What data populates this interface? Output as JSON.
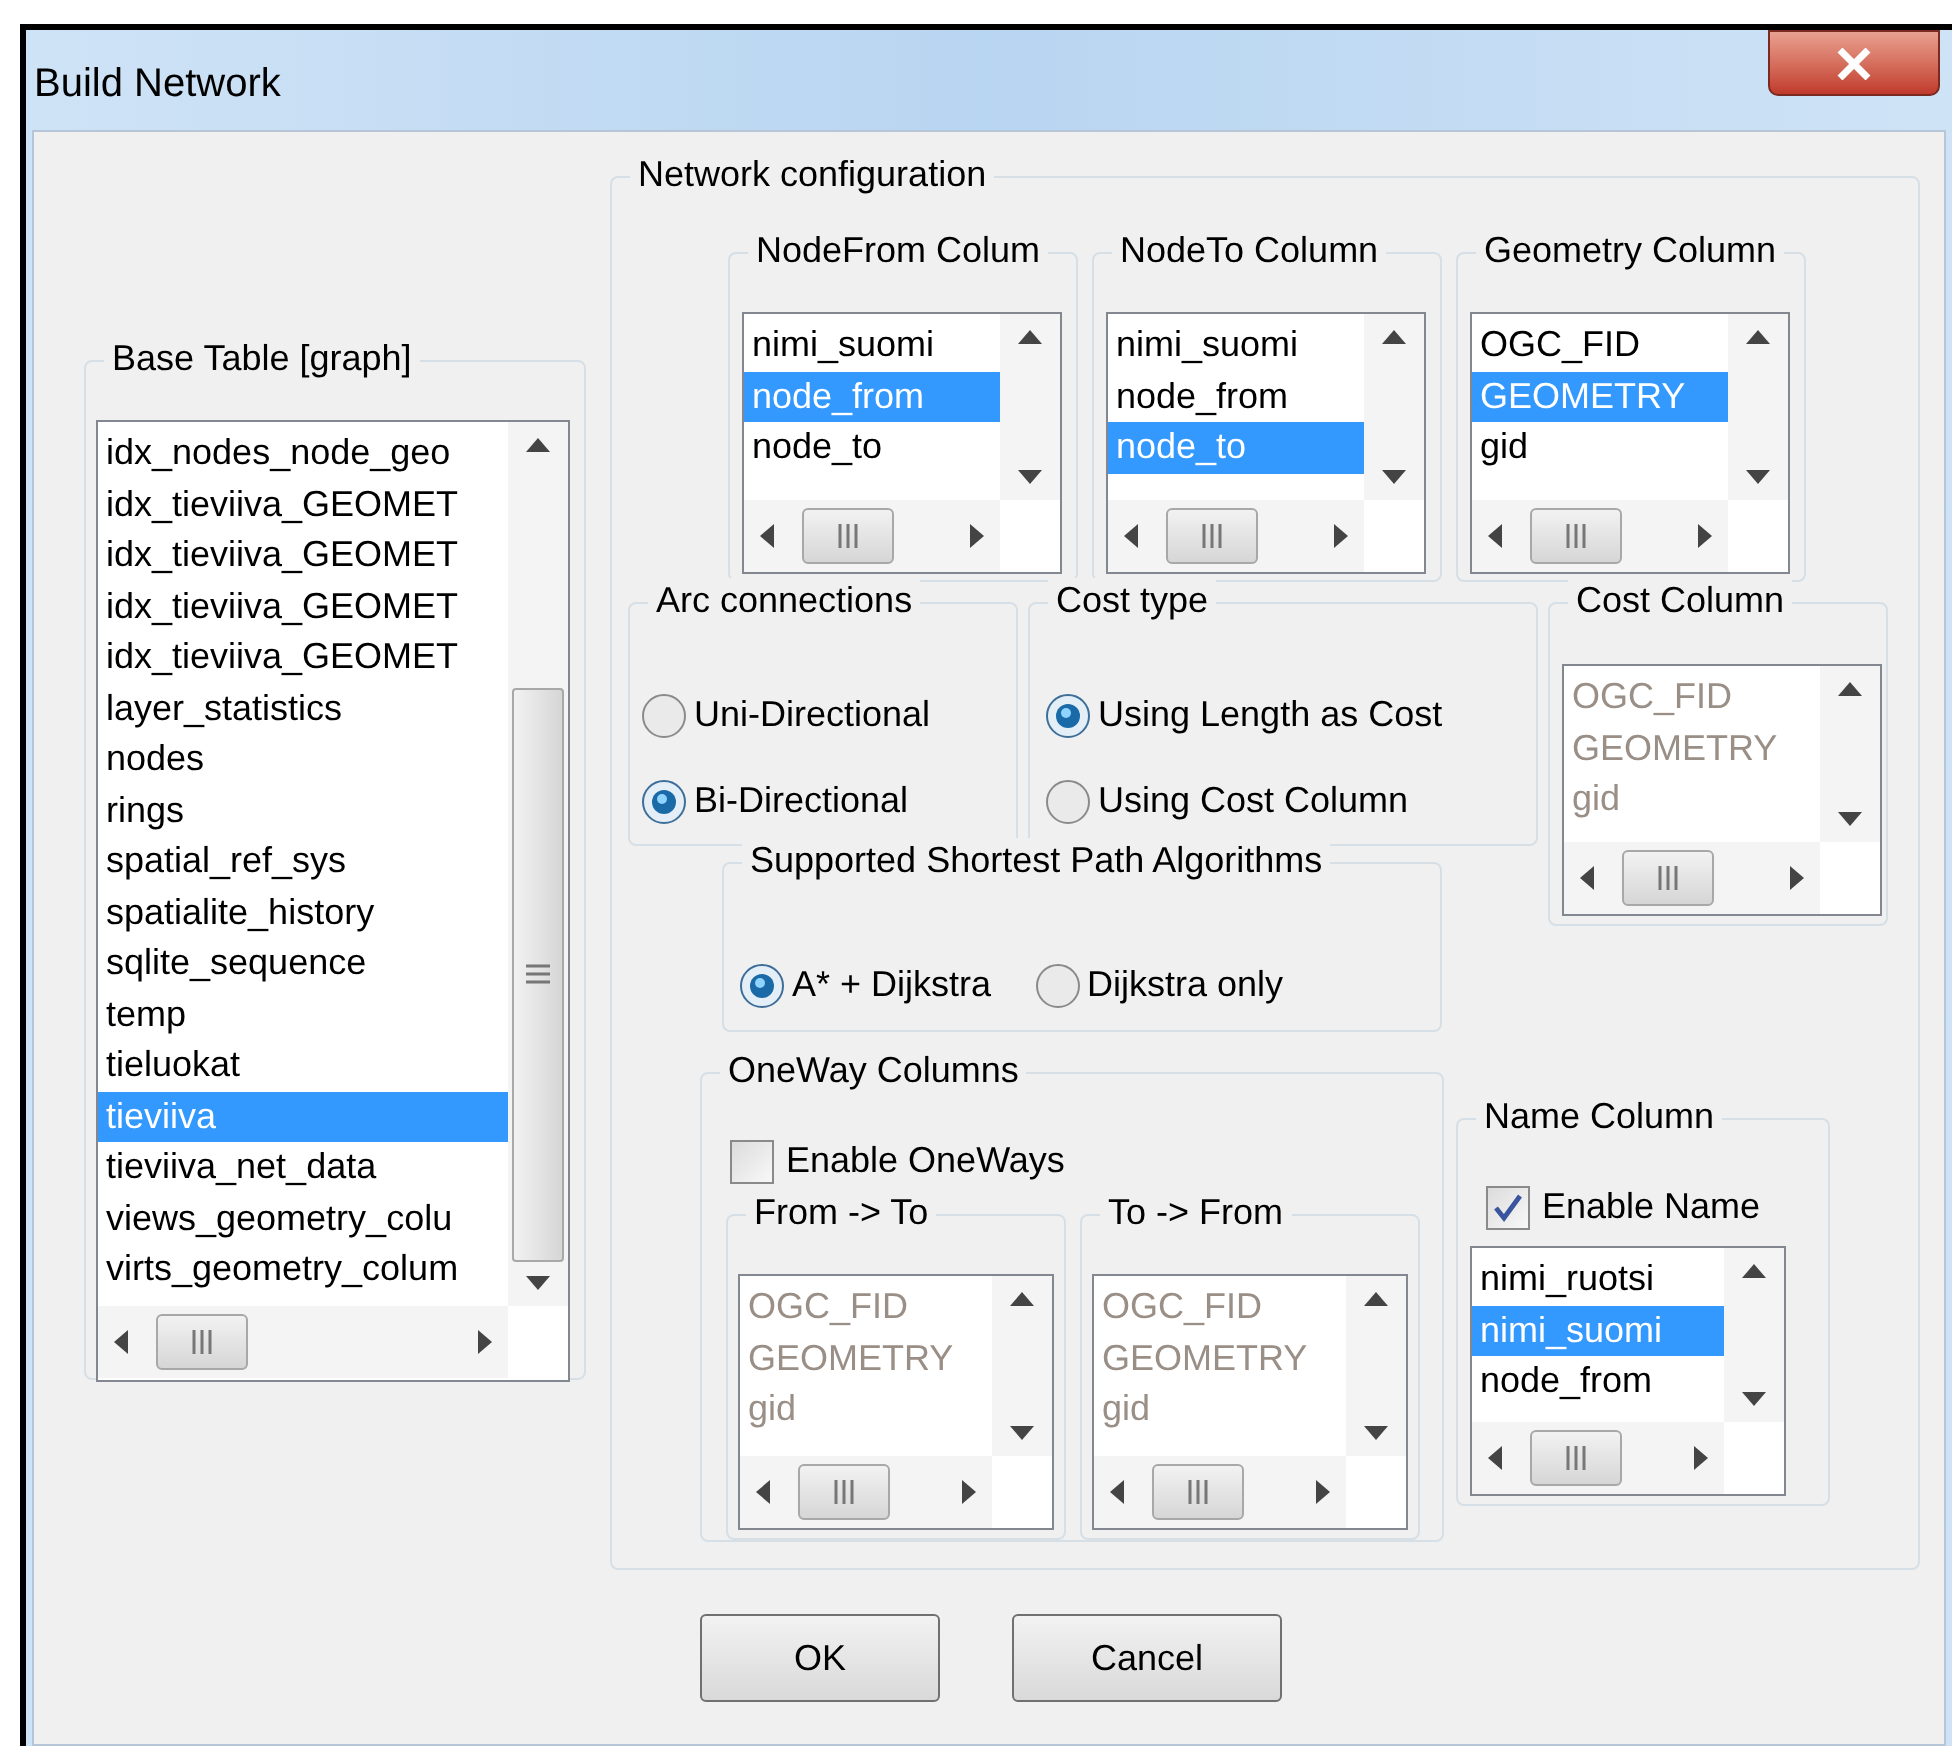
{
  "window": {
    "title": "Build Network"
  },
  "base_table": {
    "label": "Base Table [graph]",
    "items": [
      {
        "text": "idx_nodes_node_geo",
        "selected": false
      },
      {
        "text": "idx_tieviiva_GEOMET",
        "selected": false
      },
      {
        "text": "idx_tieviiva_GEOMET",
        "selected": false
      },
      {
        "text": "idx_tieviiva_GEOMET",
        "selected": false
      },
      {
        "text": "idx_tieviiva_GEOMET",
        "selected": false
      },
      {
        "text": "layer_statistics",
        "selected": false
      },
      {
        "text": "nodes",
        "selected": false
      },
      {
        "text": "rings",
        "selected": false
      },
      {
        "text": "spatial_ref_sys",
        "selected": false
      },
      {
        "text": "spatialite_history",
        "selected": false
      },
      {
        "text": "sqlite_sequence",
        "selected": false
      },
      {
        "text": "temp",
        "selected": false
      },
      {
        "text": "tieluokat",
        "selected": false
      },
      {
        "text": "tieviiva",
        "selected": true
      },
      {
        "text": "tieviiva_net_data",
        "selected": false
      },
      {
        "text": "views_geometry_colu",
        "selected": false
      },
      {
        "text": "virts_geometry_colum",
        "selected": false
      }
    ]
  },
  "network_configuration": {
    "label": "Network configuration",
    "node_from_column": {
      "label": "NodeFrom Colum",
      "disabled": false,
      "items": [
        {
          "text": "nimi_suomi",
          "selected": false
        },
        {
          "text": "node_from",
          "selected": true
        },
        {
          "text": "node_to",
          "selected": false
        }
      ]
    },
    "node_to_column": {
      "label": "NodeTo Column",
      "disabled": false,
      "items": [
        {
          "text": "nimi_suomi",
          "selected": false
        },
        {
          "text": "node_from",
          "selected": false
        },
        {
          "text": "node_to",
          "selected": true
        }
      ]
    },
    "geometry_column": {
      "label": "Geometry Column",
      "disabled": false,
      "items": [
        {
          "text": "OGC_FID",
          "selected": false
        },
        {
          "text": "GEOMETRY",
          "selected": true
        },
        {
          "text": "gid",
          "selected": false
        }
      ]
    },
    "arc_connections": {
      "label": "Arc connections",
      "options": [
        {
          "label": "Uni-Directional",
          "selected": false
        },
        {
          "label": "Bi-Directional",
          "selected": true
        }
      ]
    },
    "cost_type": {
      "label": "Cost type",
      "options": [
        {
          "label": "Using Length as Cost",
          "selected": true
        },
        {
          "label": "Using Cost Column",
          "selected": false
        }
      ]
    },
    "cost_column": {
      "label": "Cost Column",
      "disabled": true,
      "items": [
        {
          "text": "OGC_FID",
          "selected": false
        },
        {
          "text": "GEOMETRY",
          "selected": false
        },
        {
          "text": "gid",
          "selected": false
        }
      ]
    },
    "algorithms": {
      "label": "Supported Shortest Path Algorithms",
      "options": [
        {
          "label": "A* + Dijkstra",
          "selected": true
        },
        {
          "label": "Dijkstra only",
          "selected": false
        }
      ]
    },
    "oneway_columns": {
      "label": "OneWay Columns",
      "enable": {
        "label": "Enable OneWays",
        "checked": false
      },
      "from_to": {
        "label": "From -> To",
        "disabled": true,
        "items": [
          {
            "text": "OGC_FID",
            "selected": false
          },
          {
            "text": "GEOMETRY",
            "selected": false
          },
          {
            "text": "gid",
            "selected": false
          }
        ]
      },
      "to_from": {
        "label": "To -> From",
        "disabled": true,
        "items": [
          {
            "text": "OGC_FID",
            "selected": false
          },
          {
            "text": "GEOMETRY",
            "selected": false
          },
          {
            "text": "gid",
            "selected": false
          }
        ]
      }
    },
    "name_column": {
      "label": "Name Column",
      "enable": {
        "label": "Enable Name",
        "checked": true
      },
      "disabled": false,
      "items": [
        {
          "text": "nimi_ruotsi",
          "selected": false
        },
        {
          "text": "nimi_suomi",
          "selected": true
        },
        {
          "text": "node_from",
          "selected": false
        }
      ]
    }
  },
  "buttons": [
    {
      "label": "OK"
    },
    {
      "label": "Cancel"
    }
  ]
}
